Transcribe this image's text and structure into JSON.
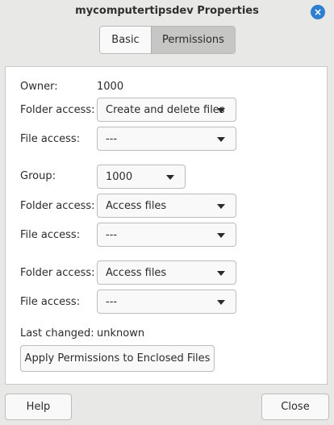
{
  "window": {
    "title": "mycomputertipsdev Properties",
    "close_glyph": "×"
  },
  "tabs": [
    {
      "label": "Basic",
      "active": false
    },
    {
      "label": "Permissions",
      "active": true
    }
  ],
  "owner": {
    "owner_label": "Owner:",
    "owner_value": "1000",
    "folder_access_label": "Folder access:",
    "folder_access_value": "Create and delete files",
    "file_access_label": "File access:",
    "file_access_value": "---"
  },
  "group": {
    "group_label": "Group:",
    "group_value": "1000",
    "folder_access_label": "Folder access:",
    "folder_access_value": "Access files",
    "file_access_label": "File access:",
    "file_access_value": "---"
  },
  "others": {
    "folder_access_label": "Folder access:",
    "folder_access_value": "Access files",
    "file_access_label": "File access:",
    "file_access_value": "---"
  },
  "last_changed": {
    "label": "Last changed:",
    "value": "unknown"
  },
  "apply_button_label": "Apply Permissions to Enclosed Files",
  "footer": {
    "help_label": "Help",
    "close_label": "Close"
  },
  "colors": {
    "accent": "#2f7fd1",
    "window_bg": "#e8e8e7",
    "panel_bg": "#ffffff"
  }
}
